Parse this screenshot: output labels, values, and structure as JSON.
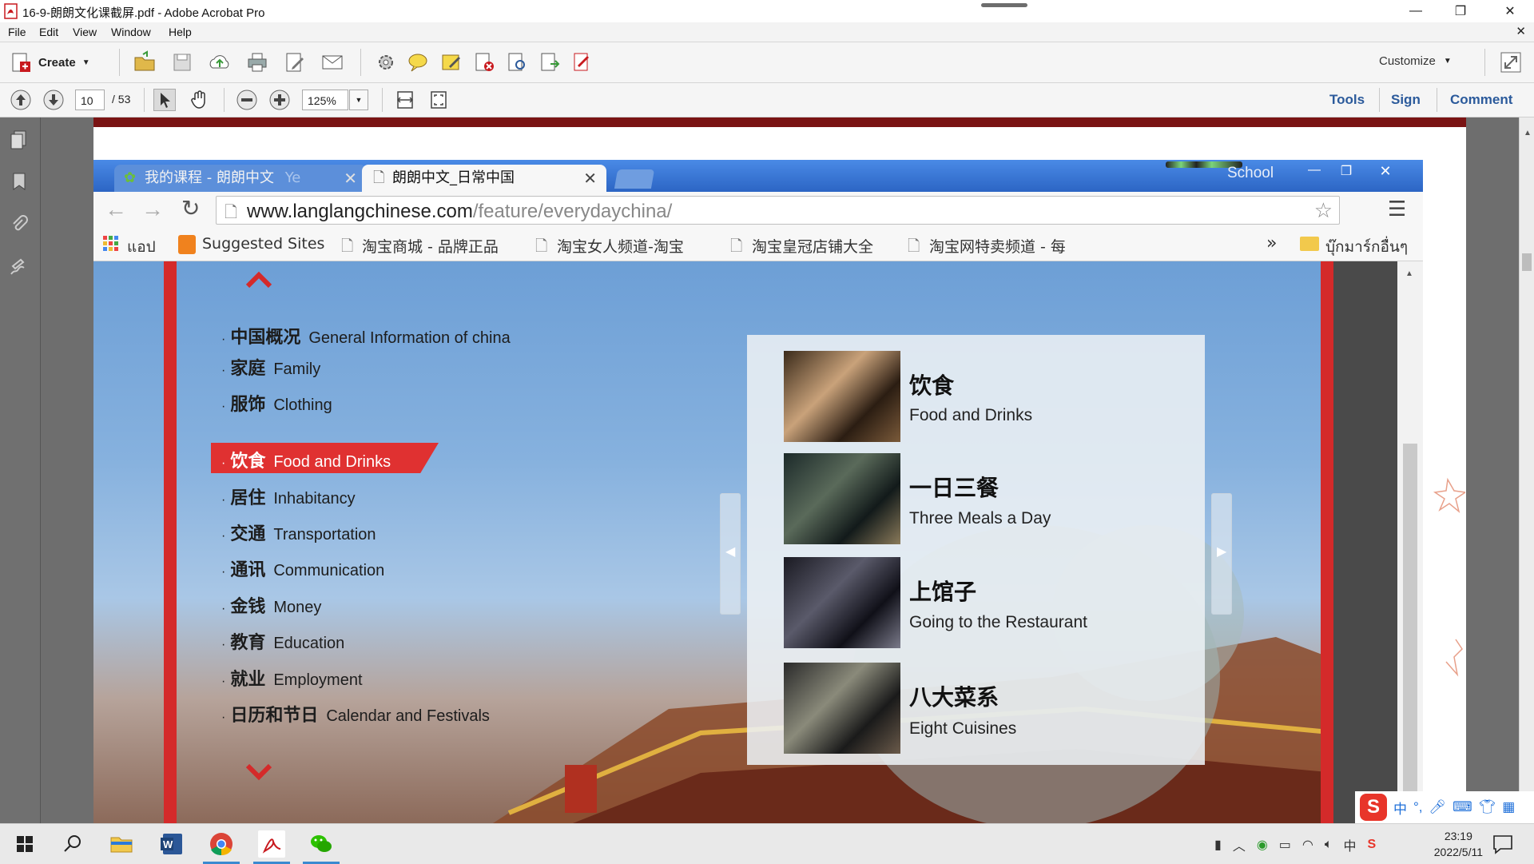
{
  "window": {
    "title": "16-9-朗朗文化课截屏.pdf - Adobe Acrobat Pro",
    "controls": [
      "—",
      "❐",
      "✕"
    ]
  },
  "menubar": {
    "items": [
      "File",
      "Edit",
      "View",
      "Window",
      "Help"
    ]
  },
  "toolbar": {
    "create_label": "Create",
    "customize_label": "Customize"
  },
  "nav": {
    "current_page": "10",
    "total_pages": "/ 53",
    "zoom": "125%",
    "links": [
      "Tools",
      "Sign",
      "Comment"
    ]
  },
  "browser": {
    "tabs": [
      {
        "label": "我的课程 - 朗朗中文",
        "faded": "Ye",
        "active": false
      },
      {
        "label": "朗朗中文_日常中国",
        "active": true
      }
    ],
    "profile": "School",
    "url": {
      "host": "www.langlangchinese.com",
      "path": "/feature/everydaychina/"
    },
    "bookmarks": [
      "แอป",
      "Suggested Sites",
      "淘宝商城 - 品牌正品",
      "淘宝女人频道-淘宝",
      "淘宝皇冠店铺大全",
      "淘宝网特卖频道 - 每"
    ],
    "bookmarks_more": "»",
    "other_bookmarks": "บุ๊กมาร์กอื่นๆ"
  },
  "site": {
    "categories": [
      {
        "zh": "中国概况",
        "en": "General Information of china",
        "active": false
      },
      {
        "zh": "家庭",
        "en": "Family",
        "active": false
      },
      {
        "zh": "服饰",
        "en": "Clothing",
        "active": false
      },
      {
        "zh": "饮食",
        "en": "Food and Drinks",
        "active": true
      },
      {
        "zh": "居住",
        "en": "Inhabitancy",
        "active": false
      },
      {
        "zh": "交通",
        "en": "Transportation",
        "active": false
      },
      {
        "zh": "通讯",
        "en": "Communication",
        "active": false
      },
      {
        "zh": "金钱",
        "en": "Money",
        "active": false
      },
      {
        "zh": "教育",
        "en": "Education",
        "active": false
      },
      {
        "zh": "就业",
        "en": "Employment",
        "active": false
      },
      {
        "zh": "日历和节日",
        "en": "Calendar and Festivals",
        "active": false
      }
    ],
    "cards": [
      {
        "zh": "饮食",
        "en": "Food and Drinks"
      },
      {
        "zh": "一日三餐",
        "en": "Three Meals a Day"
      },
      {
        "zh": "上馆子",
        "en": "Going to the Restaurant"
      },
      {
        "zh": "八大菜系",
        "en": "Eight Cuisines"
      }
    ]
  },
  "taskbar": {
    "time": "23:19",
    "date": "2022/5/11",
    "ime": "中"
  },
  "colors": {
    "acrobat_red": "#c8191e",
    "link_blue": "#2b5a9b",
    "chrome_blue": "#2f6fd0",
    "active_red": "#e03131"
  }
}
